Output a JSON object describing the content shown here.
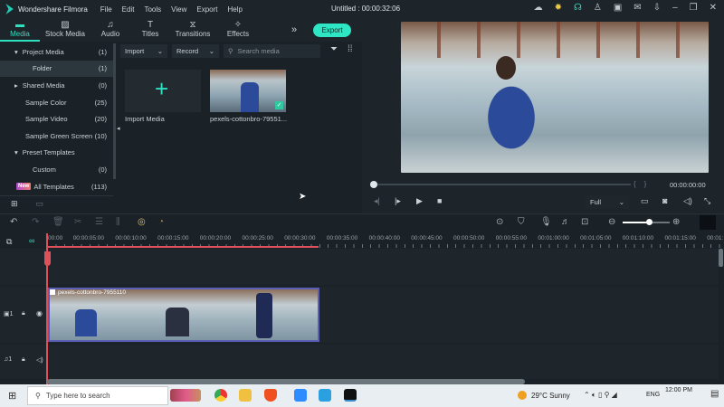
{
  "titlebar": {
    "app": "Wondershare Filmora",
    "menu": [
      "File",
      "Edit",
      "Tools",
      "View",
      "Export",
      "Help"
    ],
    "title": "Untitled : 00:00:32:06"
  },
  "tabs": [
    {
      "label": "Media",
      "icon": "folder"
    },
    {
      "label": "Stock Media",
      "icon": "image"
    },
    {
      "label": "Audio",
      "icon": "music"
    },
    {
      "label": "Titles",
      "icon": "T"
    },
    {
      "label": "Transitions",
      "icon": "transition"
    },
    {
      "label": "Effects",
      "icon": "effects"
    }
  ],
  "export_label": "Export",
  "sidebar": [
    {
      "label": "Project Media",
      "count": "(1)"
    },
    {
      "label": "Folder",
      "count": "(1)"
    },
    {
      "label": "Shared Media",
      "count": "(0)"
    },
    {
      "label": "Sample Color",
      "count": "(25)"
    },
    {
      "label": "Sample Video",
      "count": "(20)"
    },
    {
      "label": "Sample Green Screen",
      "count": "(10)"
    },
    {
      "label": "Preset Templates",
      "count": ""
    },
    {
      "label": "Custom",
      "count": "(0)"
    },
    {
      "label": "All Templates",
      "count": "(113)",
      "badge": "New"
    }
  ],
  "media_bar": {
    "import": "Import",
    "record": "Record",
    "search_placeholder": "Search media"
  },
  "media": {
    "import_label": "Import Media",
    "clip_label": "pexels-cottonbro-79551..."
  },
  "preview": {
    "timecode": "00:00:00:00",
    "quality": "Full",
    "progress": 0
  },
  "ruler": [
    "00:00",
    "00:00:05:00",
    "00:00:10:00",
    "00:00:15:00",
    "00:00:20:00",
    "00:00:25:00",
    "00:00:30:00",
    "00:00:35:00",
    "00:00:40:00",
    "00:00:45:00",
    "00:00:50:00",
    "00:00:55:00",
    "00:01:00:00",
    "00:01:05:00",
    "00:01:10:00",
    "00:01:15:00",
    "00:01:"
  ],
  "timeline": {
    "clip_name": "pexels-cottonbro-7955110",
    "video_track": "1",
    "audio_track": "1"
  },
  "taskbar": {
    "search_placeholder": "Type here to search",
    "weather": "29°C  Sunny",
    "lang": "ENG",
    "time": "12:00 PM"
  },
  "accent": "#2de0c0"
}
